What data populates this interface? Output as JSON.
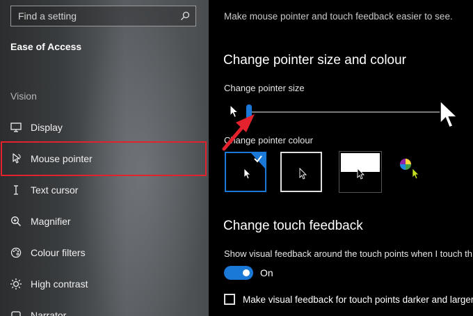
{
  "search": {
    "placeholder": "Find a setting",
    "icon": "search-icon"
  },
  "sidebar": {
    "section_title": "Ease of Access",
    "group_label": "Vision",
    "items": [
      {
        "label": "Display",
        "icon": "monitor-icon"
      },
      {
        "label": "Mouse pointer",
        "icon": "mouse-pointer-icon",
        "selected": true
      },
      {
        "label": "Text cursor",
        "icon": "text-cursor-icon"
      },
      {
        "label": "Magnifier",
        "icon": "magnifier-icon"
      },
      {
        "label": "Colour filters",
        "icon": "colour-filters-icon"
      },
      {
        "label": "High contrast",
        "icon": "high-contrast-icon"
      },
      {
        "label": "Narrator",
        "icon": "narrator-icon"
      }
    ]
  },
  "main": {
    "intro": "Make mouse pointer and touch feedback easier to see.",
    "pointer_heading": "Change pointer size and colour",
    "size_label": "Change pointer size",
    "size_slider_value": 0.0,
    "colour_label": "Change pointer colour",
    "colour_options": [
      "white",
      "black",
      "inverted",
      "custom"
    ],
    "selected_colour": "white",
    "touch_heading": "Change touch feedback",
    "touch_description": "Show visual feedback around the touch points when I touch th",
    "toggle_state": "On",
    "checkbox_label": "Make visual feedback for touch points darker and larger"
  },
  "colors": {
    "accent": "#1a78d6",
    "highlight_box": "#e3222d",
    "annotation_arrow": "#e3222d"
  }
}
